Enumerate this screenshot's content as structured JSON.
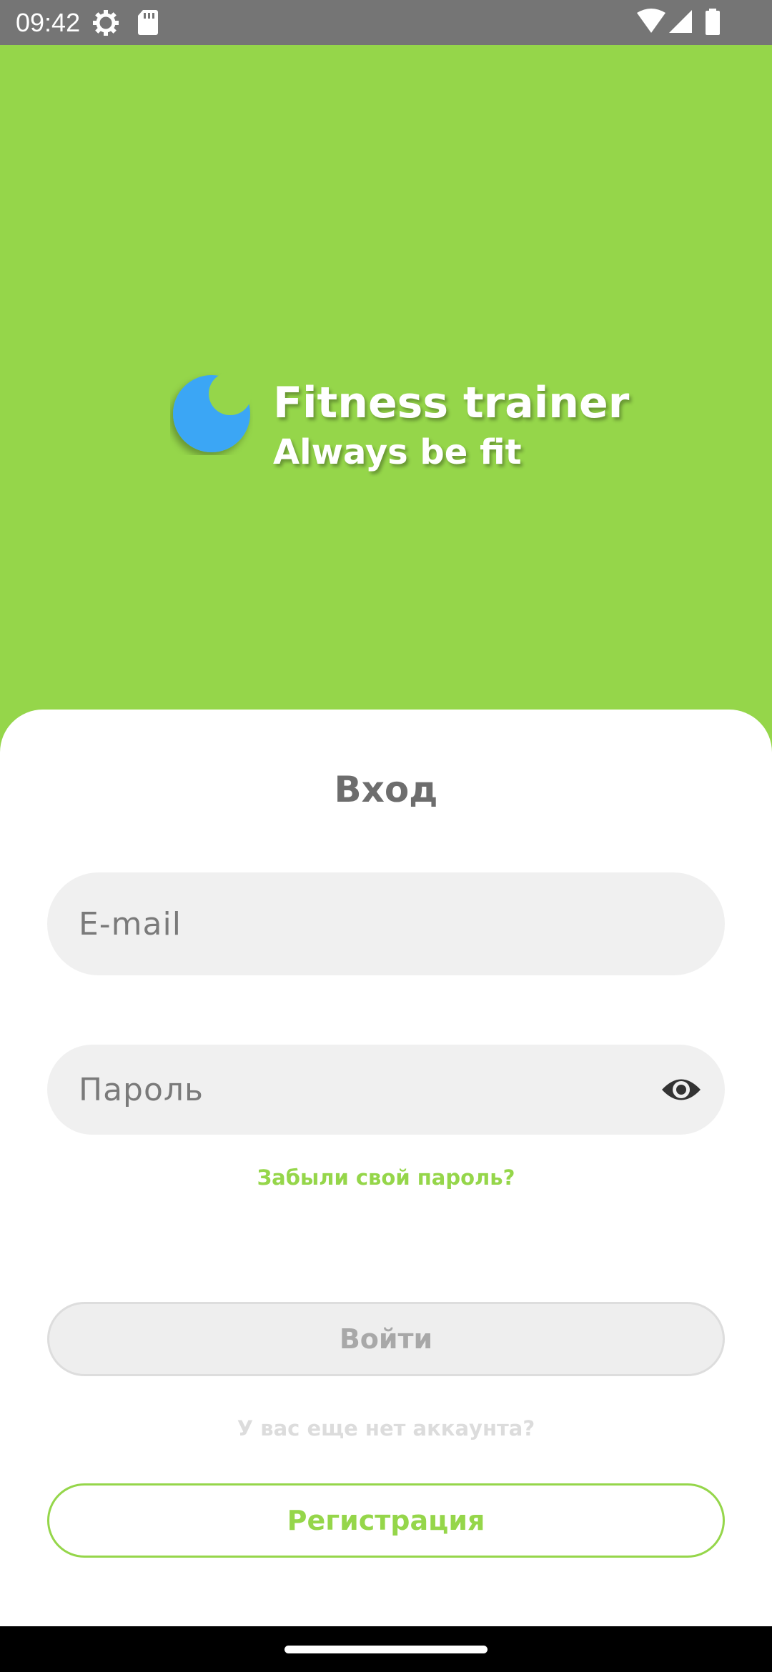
{
  "status_bar": {
    "time": "09:42",
    "icons": [
      "settings-gear-icon",
      "sd-card-icon",
      "wifi-icon",
      "signal-icon",
      "battery-icon"
    ]
  },
  "hero": {
    "logo_icon": "moon-logo-icon",
    "title": "Fitness trainer",
    "subtitle": "Always be fit"
  },
  "login_form": {
    "title": "Вход",
    "email_placeholder": "E-mail",
    "password_placeholder": "Пароль",
    "password_visibility_icon": "eye-icon",
    "forgot_password": "Забыли свой пароль?",
    "login_button": "Войти",
    "no_account_text": "У вас еще нет аккаунта?",
    "register_button": "Регистрация"
  },
  "colors": {
    "accent_green": "#95d64a",
    "logo_blue": "#3aa6f5",
    "status_bar_gray": "#757575",
    "field_background": "#f0f0f0"
  }
}
